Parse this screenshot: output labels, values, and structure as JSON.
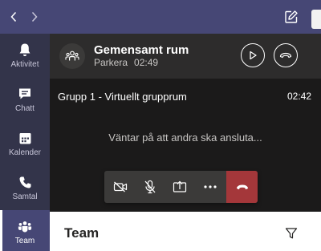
{
  "colors": {
    "topbar": "#464775",
    "rail": "#33344a",
    "rail_active": "#464775",
    "call_header": "#2d2c2c",
    "stage": "#1b1a1a",
    "controls_bar": "#3b3a39",
    "hangup": "#a4373a"
  },
  "topbar": {
    "back_icon": "chevron-left-icon",
    "forward_icon": "chevron-right-icon",
    "compose_icon": "compose-icon"
  },
  "rail": {
    "items": [
      {
        "label": "Aktivitet",
        "icon": "bell-icon",
        "active": false
      },
      {
        "label": "Chatt",
        "icon": "chat-icon",
        "active": false
      },
      {
        "label": "Kalender",
        "icon": "calendar-icon",
        "active": false
      },
      {
        "label": "Samtal",
        "icon": "phone-icon",
        "active": false
      },
      {
        "label": "Team",
        "icon": "teams-icon",
        "active": true
      }
    ]
  },
  "call_header": {
    "title": "Gemensamt rum",
    "status": "Parkera",
    "time": "02:49",
    "resume_icon": "play-icon",
    "leave_icon": "hangup-icon"
  },
  "breakout": {
    "title": "Grupp 1 - Virtuellt grupprum",
    "time": "02:42",
    "waiting_text": "Väntar på att andra ska ansluta..."
  },
  "controls": {
    "camera_icon": "camera-off-icon",
    "mic_icon": "mic-off-icon",
    "share_icon": "share-screen-icon",
    "more_icon": "more-icon",
    "hangup_icon": "hangup-icon"
  },
  "team_section": {
    "title": "Team",
    "filter_icon": "filter-icon"
  }
}
